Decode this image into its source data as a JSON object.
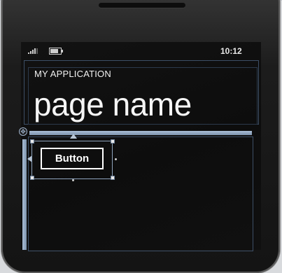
{
  "status_bar": {
    "time": "10:12",
    "signal_icon": "signal-bars-icon",
    "battery_icon": "battery-icon"
  },
  "header": {
    "app_title": "MY APPLICATION",
    "page_title": "page name"
  },
  "content": {
    "button_label": "Button"
  }
}
